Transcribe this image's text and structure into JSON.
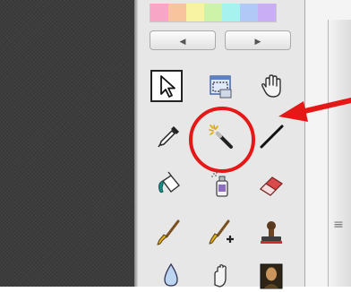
{
  "colors": {
    "palette": [
      "#f7a6c5",
      "#f8c49e",
      "#f7f3a3",
      "#cdf3a8",
      "#a6f2ef",
      "#b1c9f7",
      "#c9aef6"
    ],
    "annotation": "#e61717"
  },
  "nav": {
    "prev_glyph": "◀",
    "next_glyph": "▶"
  },
  "tools": [
    {
      "name": "select-arrow-icon",
      "selected": true
    },
    {
      "name": "marquee-select-icon"
    },
    {
      "name": "hand-icon"
    },
    {
      "name": "eyedropper-icon"
    },
    {
      "name": "magic-wand-icon",
      "highlighted": true
    },
    {
      "name": "line-icon"
    },
    {
      "name": "paint-bucket-icon"
    },
    {
      "name": "spray-can-icon"
    },
    {
      "name": "eraser-icon"
    },
    {
      "name": "brush-icon"
    },
    {
      "name": "brush-plus-icon"
    },
    {
      "name": "stamp-icon"
    },
    {
      "name": "drop-icon"
    },
    {
      "name": "smudge-icon"
    },
    {
      "name": "portrait-icon"
    }
  ],
  "scrollbar": {
    "grip_glyph": "≡"
  }
}
